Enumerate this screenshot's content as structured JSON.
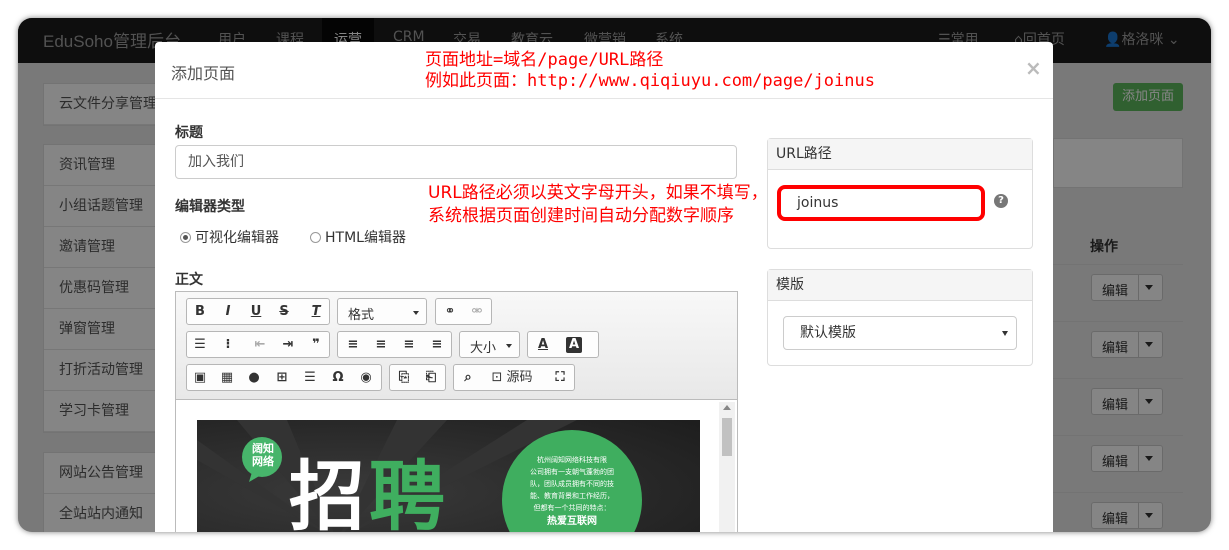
{
  "nav": {
    "brand": "EduSoho管理后台",
    "items": [
      "用户",
      "课程",
      "运营",
      "CRM",
      "交易",
      "教育云",
      "微营销",
      "系统"
    ],
    "right": {
      "common": "常用",
      "home": "回首页",
      "user": "格洛咪"
    }
  },
  "sidebar": {
    "group1": [
      "云文件分享管理"
    ],
    "group2": [
      "资讯管理",
      "小组话题管理",
      "邀请管理",
      "优惠码管理",
      "弹窗管理",
      "打折活动管理",
      "学习卡管理"
    ],
    "group3": [
      "网站公告管理",
      "全站站内通知"
    ]
  },
  "page": {
    "add_button": "添加页面",
    "ops_header": "操作",
    "edit_label": "编辑"
  },
  "modal": {
    "title": "添加页面",
    "close": "×",
    "annotation_top": [
      "页面地址=域名/page/URL路径",
      "例如此页面：http://www.qiqiuyu.com/page/joinus"
    ],
    "annotation_url": "URL路径必须以英文字母开头，如果不填写，系统根据页面创建时间自动分配数字顺序",
    "title_label": "标题",
    "title_value": "加入我们",
    "editor_type_label": "编辑器类型",
    "editor_options": [
      "可视化编辑器",
      "HTML编辑器"
    ],
    "body_label": "正文",
    "toolbar": {
      "format": "格式",
      "size": "大小",
      "source": "源码"
    },
    "url_panel": {
      "header": "URL路径",
      "value": "joinus",
      "help": "?"
    },
    "template_panel": {
      "header": "模版",
      "selected": "默认模版"
    },
    "poster": {
      "badge": [
        "阔知",
        "网络"
      ],
      "big_text": [
        "招",
        "聘"
      ],
      "circle_text": [
        "杭州阔知网络科技有限",
        "公司拥有一支朝气蓬勃的团",
        "队，团队成员拥有不同的技",
        "能、教育背景和工作经历，",
        "但都有一个共同的特点："
      ],
      "slogan": "热爱互联网"
    }
  },
  "colors": {
    "annotation": "#ff0000",
    "green": "#5cb85c",
    "nav_bg": "#1b1b1b"
  }
}
